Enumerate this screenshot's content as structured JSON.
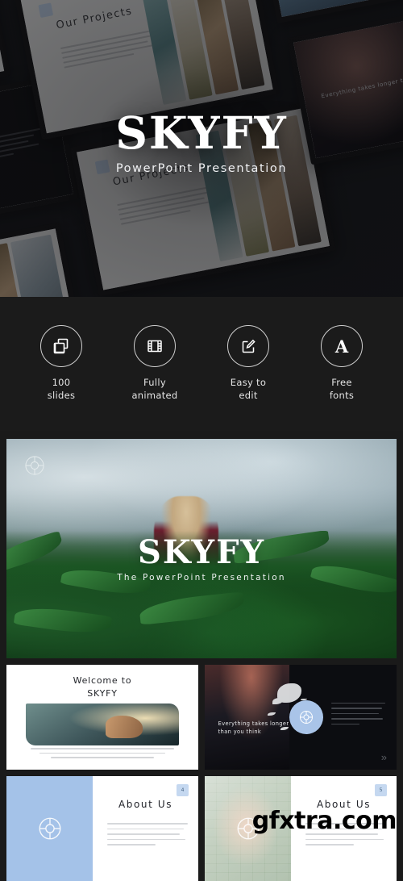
{
  "hero": {
    "title": "SKYFY",
    "subtitle": "PowerPoint Presentation",
    "mockup_slide_title": "Our Projects",
    "mockup_quote": "Everything takes longer\nthan you think"
  },
  "features": {
    "items": [
      {
        "icon": "slides-copy-icon",
        "label_line1": "100",
        "label_line2": "slides"
      },
      {
        "icon": "film-strip-icon",
        "label_line1": "Fully",
        "label_line2": "animated"
      },
      {
        "icon": "pencil-edit-icon",
        "label_line1": "Easy to",
        "label_line2": "edit"
      },
      {
        "icon": "font-letter-a-icon",
        "label_line1": "Free",
        "label_line2": "fonts"
      }
    ]
  },
  "showcase": {
    "logo": "skyfy-circle-logo-icon",
    "title": "SKYFY",
    "subtitle": "The PowerPoint Presentation"
  },
  "slides": {
    "welcome": {
      "title_line1": "Welcome to",
      "title_line2": "SKYFY"
    },
    "quote": {
      "text_line1": "Everything takes longer",
      "text_line2": "than you think",
      "logo": "skyfy-circle-logo-icon",
      "next_arrow": "»"
    },
    "about_1": {
      "title": "About Us",
      "number": "4",
      "logo": "skyfy-circle-logo-icon"
    },
    "about_2": {
      "title": "About Us",
      "number": "5",
      "logo": "skyfy-circle-logo-icon"
    }
  },
  "watermark": {
    "text": "gfxtra.com"
  },
  "colors": {
    "background_dark": "#1a1a1a",
    "accent_blue": "#a4c2e8",
    "badge_blue": "#c5d8f0",
    "text_light": "#ffffff",
    "slide_white": "#ffffff",
    "slide_dark": "#0c0d11"
  }
}
